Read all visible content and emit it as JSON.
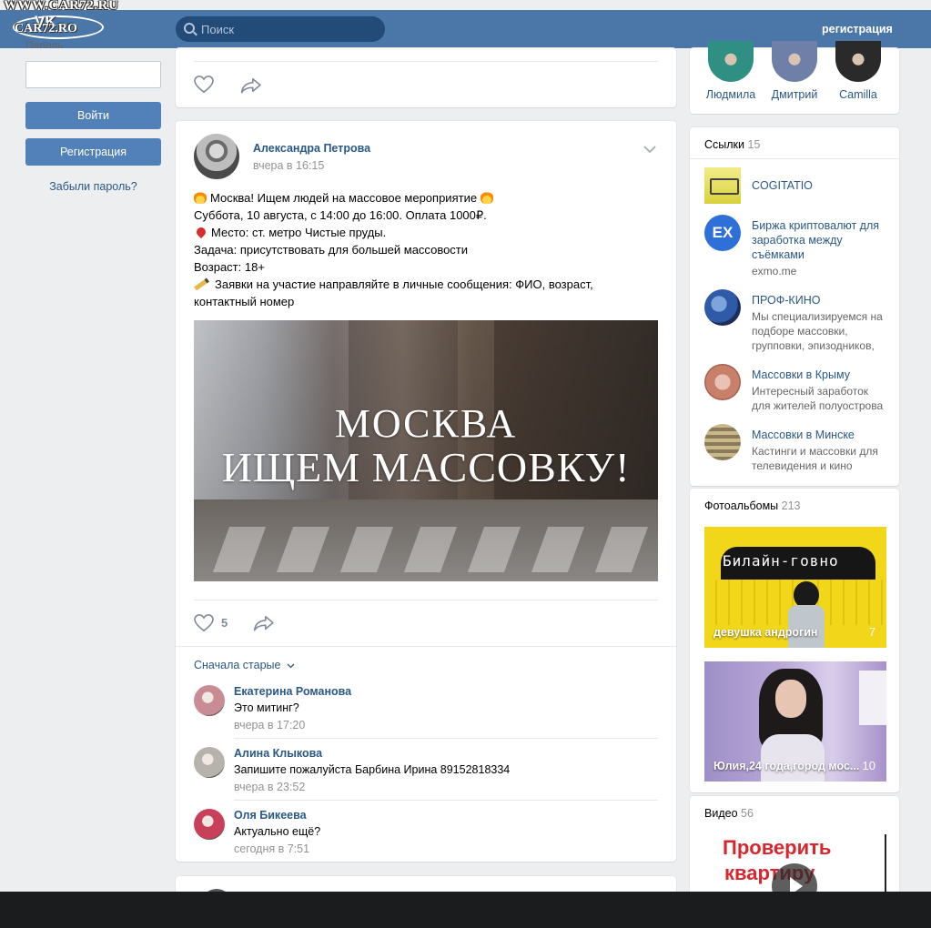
{
  "watermark": "WWW.CAR72.RU",
  "logo": {
    "vk": "VK",
    "site": "CAR72.RO"
  },
  "header": {
    "search_placeholder": "Поиск",
    "register_link": "регистрация"
  },
  "login": {
    "password_label": "Пароль",
    "login_button": "Войти",
    "register_button": "Регистрация",
    "forgot_link": "Забыли пароль?"
  },
  "post": {
    "author": "Александра Петрова",
    "time": "вчера в 16:15",
    "lines": [
      "Москва! Ищем людей на массовое мероприятие",
      "Суббота, 10 августа, с 14:00 до 16:00. Оплата 1000₽.",
      "Место: ст. метро Чистые пруды.",
      "Задача: присутствовать для большей массовости",
      "Возраст: 18+",
      "Заявки на участие направляйте в личные сообщения: ФИО, возраст,",
      "контактный номер"
    ],
    "image_line1": "МОСКВА",
    "image_line2": "ИЩЕМ МАССОВКУ!",
    "likes": "5",
    "sort_label": "Сначала старые",
    "comments": [
      {
        "author": "Екатерина Романова",
        "text": "Это митинг?",
        "time": "вчера в 17:20",
        "color": "#c98b94"
      },
      {
        "author": "Алина Клыкова",
        "text": "Запишите пожалуйста Барбина Ирина 89152818334",
        "time": "вчера в 23:52",
        "color": "#b8b2ac"
      },
      {
        "author": "Оля Бикеева",
        "text": "Актуально ещё?",
        "time": "сегодня в 7:51",
        "color": "#c9405a"
      }
    ]
  },
  "friends": [
    {
      "name": "Людмила",
      "color": "#2f8f82"
    },
    {
      "name": "Дмитрий",
      "color": "#6e7fa8"
    },
    {
      "name": "Camilla",
      "color": "#2a2a2a"
    }
  ],
  "links": {
    "title": "Ссылки",
    "count": "15",
    "items": [
      {
        "title": "COGITATIO",
        "desc": "",
        "color": "#e9e26a"
      },
      {
        "title": "Биржа криптовалют для заработка между съёмками",
        "desc": "exmo.me",
        "color": "#2f6fd8",
        "badge": "EX"
      },
      {
        "title": "ПРОФ-КИНО",
        "desc": "Мы специализируемся на подборе массовки, групповки, эпизодников,",
        "color": "#2f5aa8"
      },
      {
        "title": "Массовки в Крыму",
        "desc": "Интересный заработок для жителей полуострова",
        "color": "#d49a86"
      },
      {
        "title": "Массовки в Минске",
        "desc": "Кастинги и массовки для телевидения и кино",
        "color": "#8a7a58"
      }
    ]
  },
  "albums": {
    "title": "Фотоальбомы",
    "count": "213",
    "items": [
      {
        "caption": "девушка андрогин",
        "count": "7",
        "board_text": "Билайн-говно"
      },
      {
        "caption": "Юлия,24 года,город мос...",
        "count": "10"
      }
    ]
  },
  "video": {
    "title": "Видео",
    "count": "56",
    "thumb_line1": "Проверить",
    "thumb_line2": "квартиру"
  }
}
